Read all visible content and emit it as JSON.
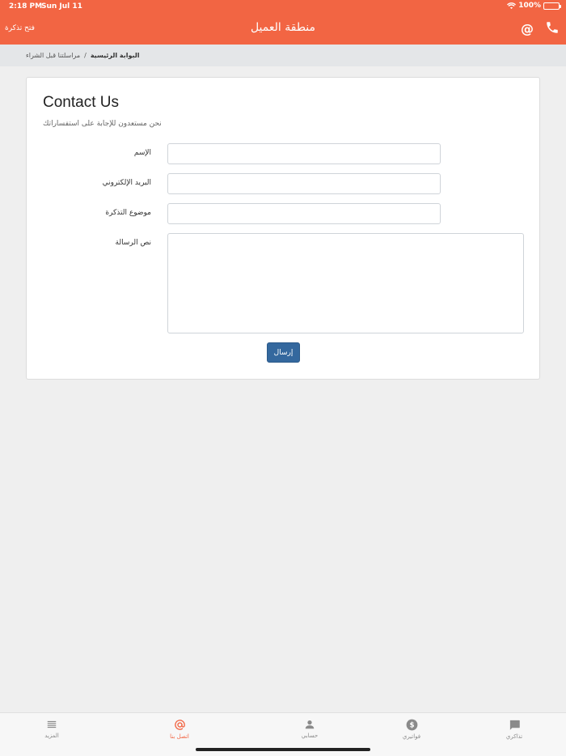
{
  "status_bar": {
    "time": "2:18 PM",
    "date": "Sun Jul 11",
    "battery": "100%"
  },
  "header": {
    "title": "منطقة العميل",
    "open_ticket": "فتح تذكرة",
    "email_icon": "at-icon",
    "phone_icon": "phone-icon"
  },
  "breadcrumb": {
    "home": "البوابة الرئيسية",
    "separator": "/",
    "current": "مراسلتنا قبل الشراء"
  },
  "form": {
    "title": "Contact Us",
    "subtitle": "نحن مستعدون للإجابة على استفساراتك",
    "name_label": "الإسم",
    "name_value": "",
    "email_label": "البريد الإلكتروني",
    "email_value": "",
    "subject_label": "موضوع التذكرة",
    "subject_value": "",
    "message_label": "نص الرسالة",
    "message_value": "",
    "submit_label": "إرسال"
  },
  "tabbar": {
    "tabs": [
      {
        "label": "المزيد",
        "icon": "list-icon"
      },
      {
        "label": "اتصل بنا",
        "icon": "at-icon",
        "active": true
      },
      {
        "label": "حسابي",
        "icon": "person-icon"
      },
      {
        "label": "فواتيري",
        "icon": "dollar-icon"
      },
      {
        "label": "تذاكري",
        "icon": "chat-icon"
      }
    ]
  },
  "colors": {
    "accent": "#f26543",
    "button": "#34689e"
  }
}
